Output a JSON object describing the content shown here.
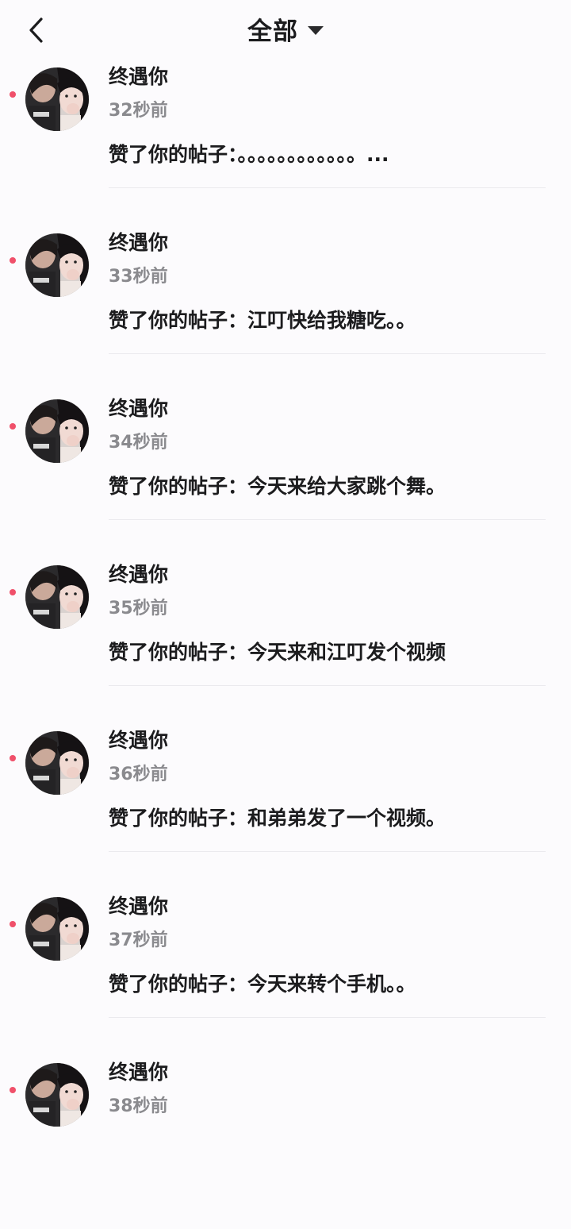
{
  "header": {
    "title": "全部",
    "back_icon": "chevron-left-icon",
    "dropdown_icon": "caret-down-icon"
  },
  "notifications": [
    {
      "name": "终遇你",
      "time": "32秒前",
      "action": "赞了你的帖子：。。。。。。。。。。。。..."
    },
    {
      "name": "终遇你",
      "time": "33秒前",
      "action": "赞了你的帖子：江叮快给我糖吃。。"
    },
    {
      "name": "终遇你",
      "time": "34秒前",
      "action": "赞了你的帖子：今天来给大家跳个舞。"
    },
    {
      "name": "终遇你",
      "time": "35秒前",
      "action": "赞了你的帖子：今天来和江叮发个视频"
    },
    {
      "name": "终遇你",
      "time": "36秒前",
      "action": "赞了你的帖子：和弟弟发了一个视频。"
    },
    {
      "name": "终遇你",
      "time": "37秒前",
      "action": "赞了你的帖子：今天来转个手机。。"
    },
    {
      "name": "终遇你",
      "time": "38秒前",
      "action": ""
    }
  ],
  "colors": {
    "unread_dot": "#f0506a",
    "time_text": "#8a8a8e",
    "background": "#fcfbfd"
  }
}
